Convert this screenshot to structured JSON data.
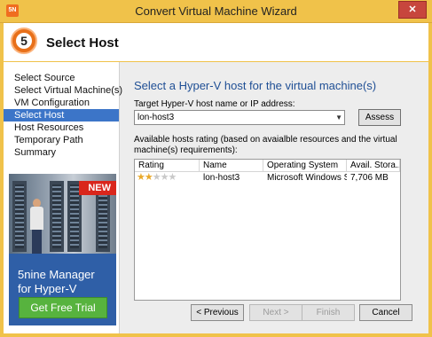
{
  "window": {
    "title": "Convert Virtual Machine Wizard",
    "icon_text": "5N",
    "close_label": "✕"
  },
  "header": {
    "step_number": "5",
    "title": "Select Host"
  },
  "sidebar": {
    "items": [
      {
        "label": "Select Source",
        "active": false
      },
      {
        "label": "Select Virtual Machine(s)",
        "active": false
      },
      {
        "label": "VM Configuration",
        "active": false
      },
      {
        "label": "Select Host",
        "active": true
      },
      {
        "label": "Host Resources",
        "active": false
      },
      {
        "label": "Temporary Path",
        "active": false
      },
      {
        "label": "Summary",
        "active": false
      }
    ]
  },
  "ad": {
    "badge": "NEW",
    "line1": "5nine Manager",
    "line2": "for Hyper-V",
    "button": "Get Free Trial"
  },
  "main": {
    "heading": "Select a Hyper-V host for the virtual machine(s)",
    "target_label": "Target Hyper-V host name or IP address:",
    "host_value": "lon-host3",
    "assess_label": "Assess",
    "available_label": "Available hosts rating (based on avaialble resources and the virtual machine(s) requirements):",
    "table": {
      "columns": [
        "Rating",
        "Name",
        "Operating System",
        "Avail. Stora..."
      ],
      "rows": [
        {
          "rating": 2,
          "rating_max": 5,
          "name": "lon-host3",
          "os": "Microsoft Windows S...",
          "storage": "7,706 MB"
        }
      ]
    }
  },
  "footer": {
    "previous": "< Previous",
    "next": "Next >",
    "finish": "Finish",
    "cancel": "Cancel"
  }
}
